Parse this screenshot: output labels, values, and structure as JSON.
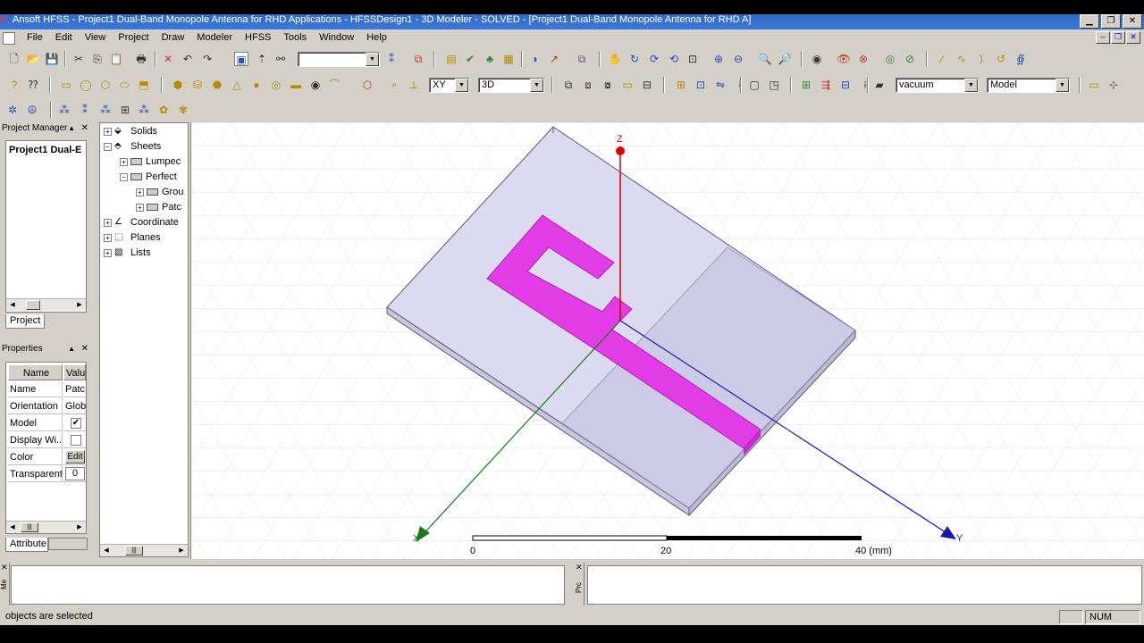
{
  "window": {
    "title": "Ansoft HFSS - Project1 Dual-Band Monopole Antenna for RHD Applications - HFSSDesign1 - 3D Modeler - SOLVED - [Project1 Dual-Band Monopole Antenna for RHD A]"
  },
  "menu": [
    "File",
    "Edit",
    "View",
    "Project",
    "Draw",
    "Modeler",
    "HFSS",
    "Tools",
    "Window",
    "Help"
  ],
  "toolbar": {
    "plane": "XY",
    "dimension": "3D",
    "material": "vacuum",
    "mode": "Model"
  },
  "project_manager": {
    "title": "Project Manager",
    "project_label": "Project1 Dual-E",
    "tab": "Project"
  },
  "tree": {
    "items": [
      "Solids",
      "Sheets",
      "Lumpec",
      "Perfect",
      "Grou",
      "Patc",
      "Coordinate",
      "Planes",
      "Lists"
    ]
  },
  "properties": {
    "title": "Properties",
    "col_name": "Name",
    "col_value": "Valu",
    "rows": [
      {
        "name": "Name",
        "value": "Patc"
      },
      {
        "name": "Orientation",
        "value": "Glob"
      },
      {
        "name": "Model",
        "value": "✔"
      },
      {
        "name": "Display Wi...",
        "value": ""
      },
      {
        "name": "Color",
        "value": "Edit"
      },
      {
        "name": "Transparent",
        "value": "0"
      }
    ],
    "tab": "Attribute"
  },
  "viewport": {
    "axis_z": "Z",
    "axis_y": "Y",
    "axis_x": "X",
    "scale_0": "0",
    "scale_20": "20",
    "scale_40": "40 (mm)"
  },
  "bottom": {
    "msg_side": "Me",
    "prog_side": "Prc"
  },
  "status": {
    "text": "objects are selected",
    "num": "NUM"
  },
  "colors": {
    "patch": "#e23ce6",
    "substrate": "#d9d6ef",
    "axis_z": "#d40000",
    "axis_y": "#1a1aa8",
    "axis_x": "#1a7a1a"
  }
}
